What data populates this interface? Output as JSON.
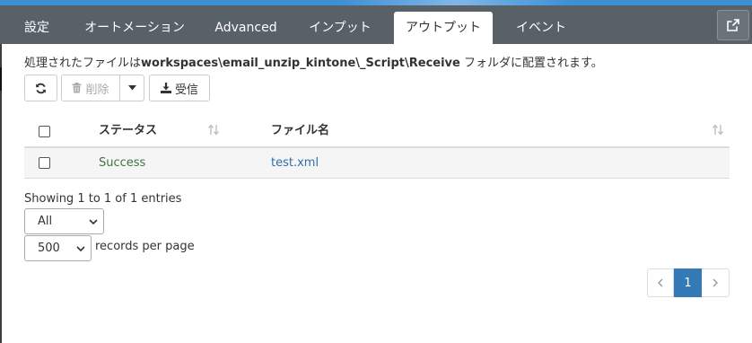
{
  "tabs": [
    "設定",
    "オートメーション",
    "Advanced",
    "インプット",
    "アウトプット",
    "イベント"
  ],
  "active_tab": "アウトプット",
  "info": {
    "prefix": "処理されたファイルは",
    "path": "workspaces\\email_unzip_kintone\\_Script\\Receive",
    "suffix": " フォルダに配置されます。"
  },
  "toolbar": {
    "delete_label": "削除",
    "receive_label": "受信"
  },
  "table": {
    "headers": {
      "status": "ステータス",
      "filename": "ファイル名"
    },
    "rows": [
      {
        "status": "Success",
        "filename": "test.xml"
      }
    ]
  },
  "showing_text": "Showing 1 to 1 of 1 entries",
  "filter_select": {
    "value": "All"
  },
  "page_size_select": {
    "value": "500"
  },
  "records_per_page_label": "records per page",
  "pagination": {
    "current": "1"
  },
  "colors": {
    "tabbar": "#586068",
    "accent": "#337ab7",
    "success": "#3c763d",
    "link": "#2f6fa7"
  }
}
